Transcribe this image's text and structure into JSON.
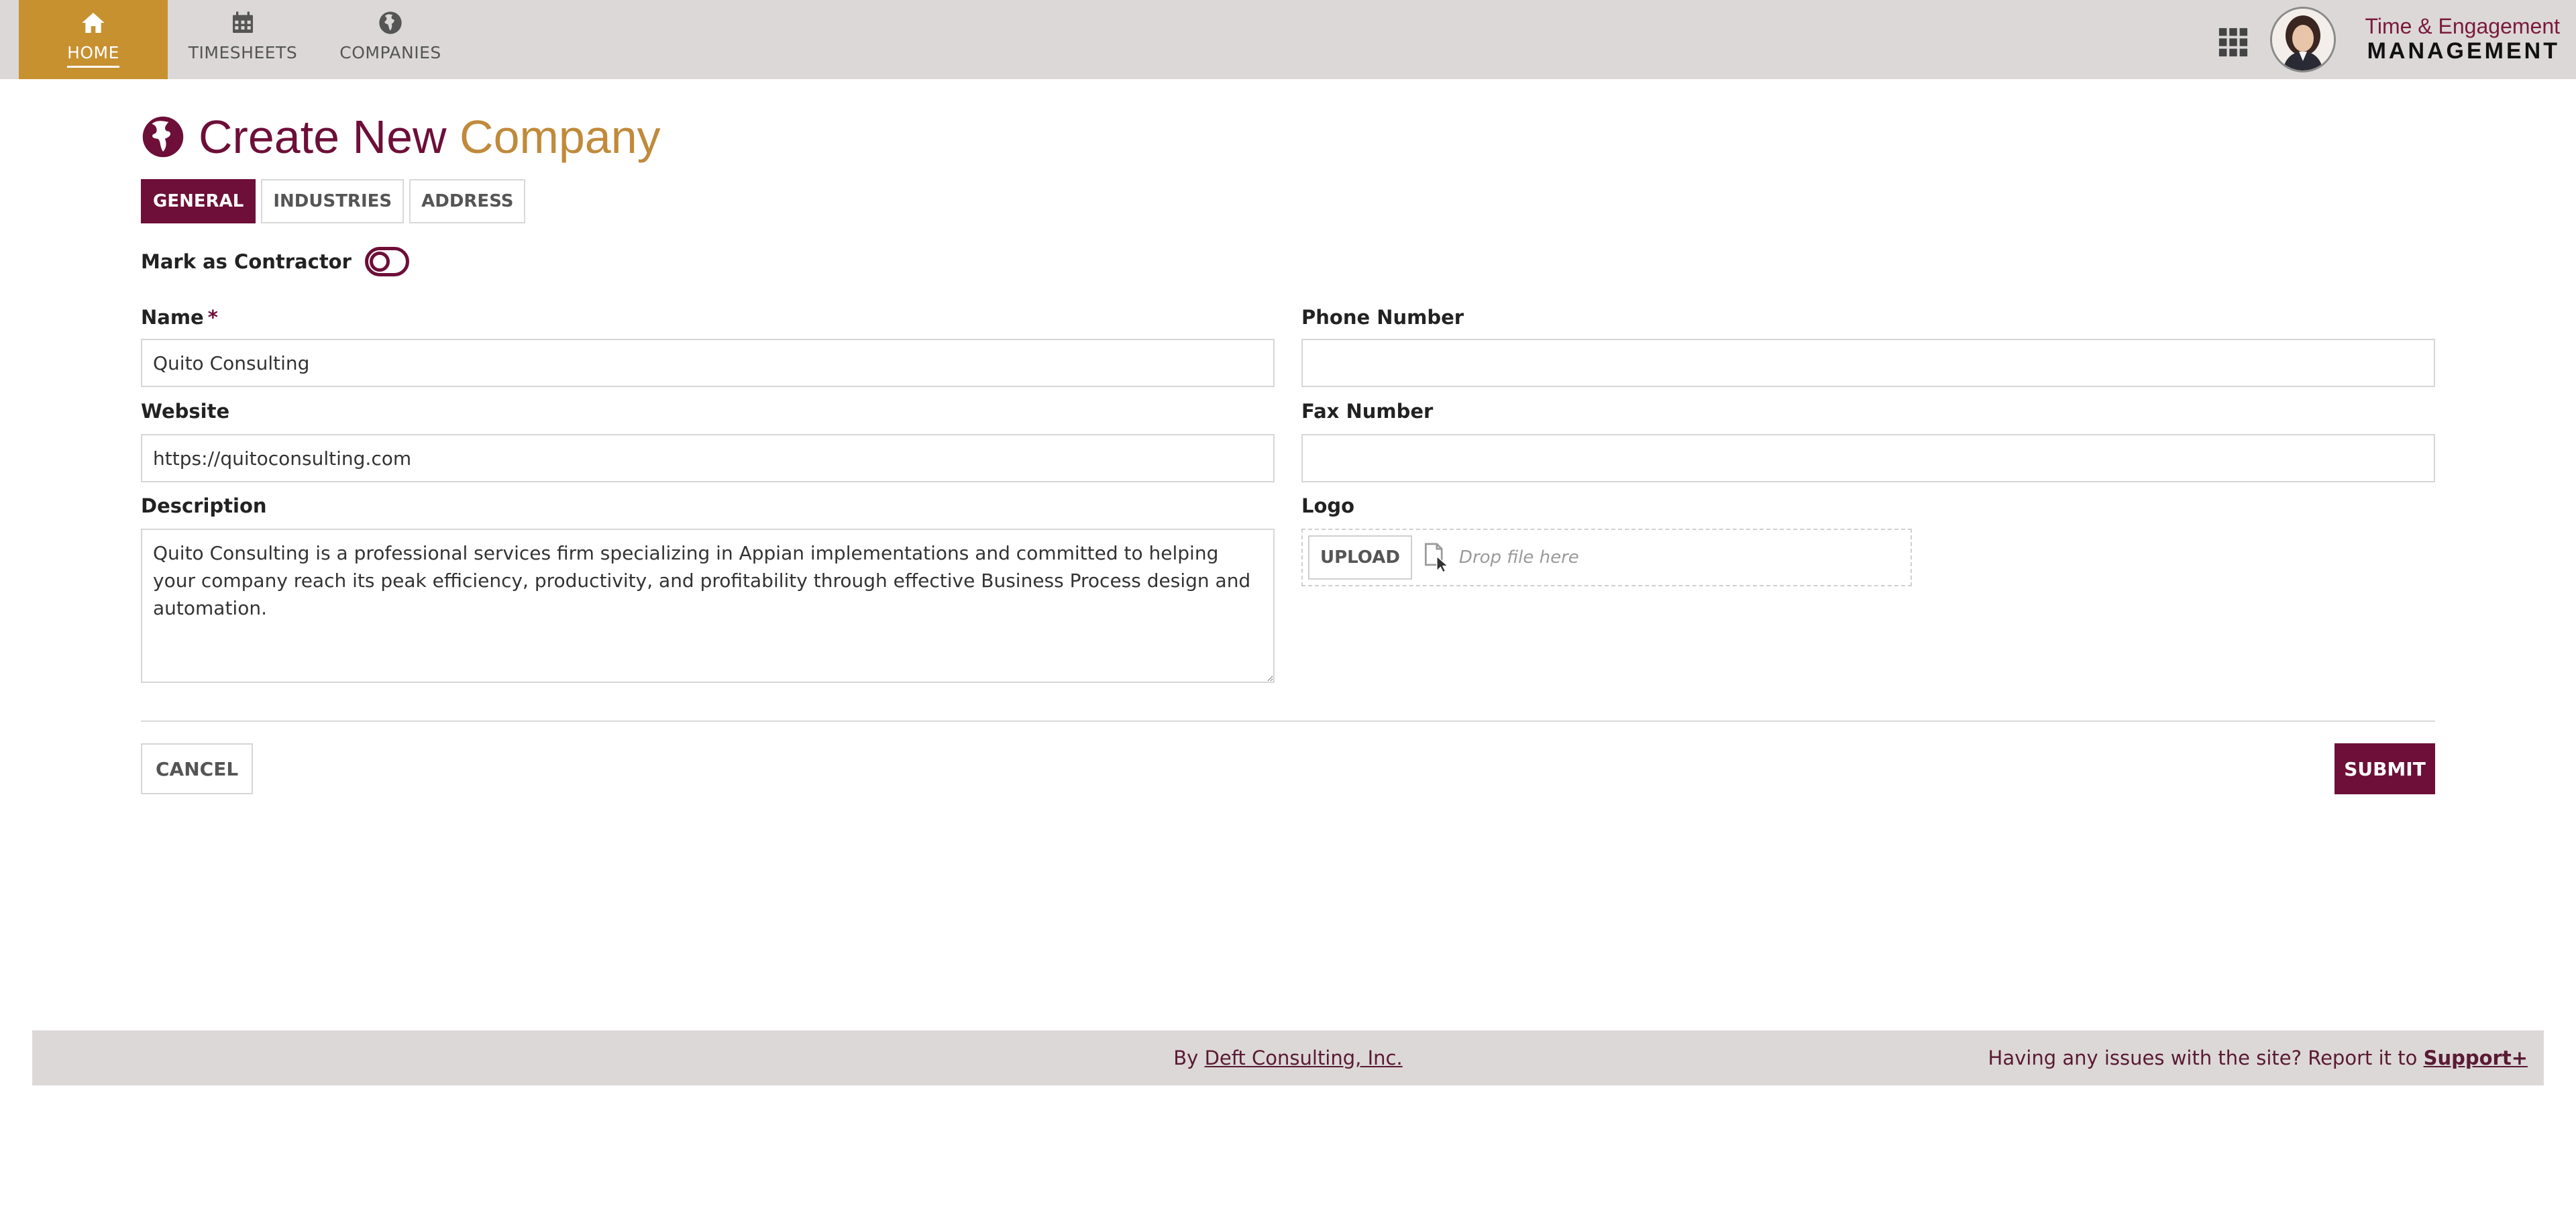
{
  "nav": {
    "items": [
      {
        "label": "HOME",
        "icon": "home-icon",
        "active": true
      },
      {
        "label": "TIMESHEETS",
        "icon": "calendar-icon",
        "active": false
      },
      {
        "label": "COMPANIES",
        "icon": "globe-icon",
        "active": false
      }
    ]
  },
  "brand": {
    "line1": "Time & Engagement",
    "line2": "MANAGEMENT"
  },
  "page": {
    "title_part1": "Create New",
    "title_part2": "Company"
  },
  "tabs": [
    {
      "label": "GENERAL",
      "active": true
    },
    {
      "label": "INDUSTRIES",
      "active": false
    },
    {
      "label": "ADDRESS",
      "active": false
    }
  ],
  "form": {
    "contractor_label": "Mark as Contractor",
    "name_label": "Name",
    "required_mark": "*",
    "name_value": "Quito Consulting",
    "website_label": "Website",
    "website_value": "https://quitoconsulting.com",
    "description_label": "Description",
    "description_value": "Quito Consulting is a professional services firm specializing in Appian implementations and committed to helping your company reach its peak efficiency, productivity, and profitability through effective Business Process design and automation.",
    "phone_label": "Phone Number",
    "phone_value": "",
    "fax_label": "Fax Number",
    "fax_value": "",
    "logo_label": "Logo",
    "upload_label": "UPLOAD",
    "drop_text": "Drop file here"
  },
  "actions": {
    "cancel_label": "CANCEL",
    "submit_label": "SUBMIT"
  },
  "footer": {
    "by_text": "By",
    "company_link": "Deft Consulting, Inc.",
    "issues_text": "Having any issues with the site? Report it to",
    "support_link": "Support+"
  },
  "colors": {
    "primary": "#6d0f38",
    "accent": "#c79130",
    "title_accent": "#c08a3b",
    "nav_bg": "#dcd8d8"
  }
}
